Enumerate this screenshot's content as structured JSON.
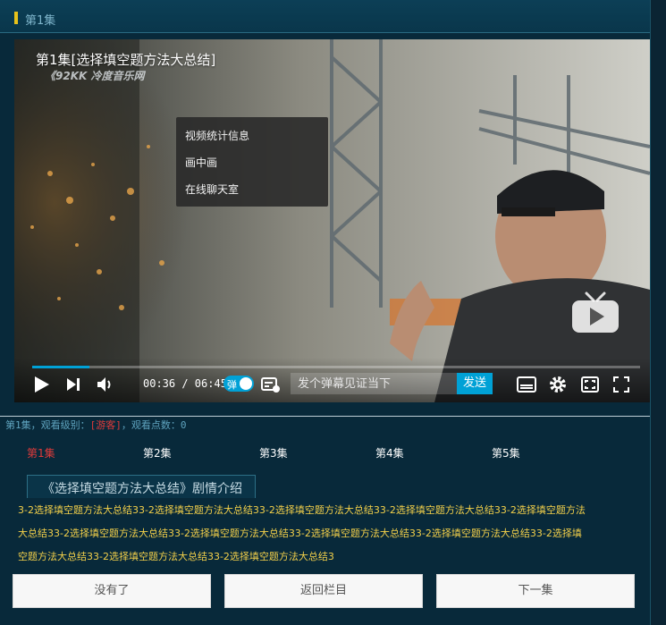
{
  "header": {
    "title": "第1集"
  },
  "player": {
    "video_title": "第1集[选择填空题方法大总结]",
    "watermark": "《92KK 冷度音乐网",
    "context_menu": [
      "视频统计信息",
      "画中画",
      "在线聊天室"
    ],
    "progress": 0.094,
    "time": "00:36 / 06:45",
    "danmaku_label": "弹",
    "danmaku_placeholder": "发个弹幕见证当下",
    "send_label": "发送"
  },
  "info": {
    "episode": "第1集，观看级别：",
    "guest": "[游客]",
    "points": "，观看点数：0"
  },
  "episodes": [
    {
      "label": "第1集",
      "active": true
    },
    {
      "label": "第2集",
      "active": false
    },
    {
      "label": "第3集",
      "active": false
    },
    {
      "label": "第4集",
      "active": false
    },
    {
      "label": "第5集",
      "active": false
    }
  ],
  "synopsis_tab": "《选择填空题方法大总结》剧情介绍",
  "synopsis_lines": [
    "3-2选择填空题方法大总结33-2选择填空题方法大总结33-2选择填空题方法大总结33-2选择填空题方法大总结33-2选择填空题方法",
    "大总结33-2选择填空题方法大总结33-2选择填空题方法大总结33-2选择填空题方法大总结33-2选择填空题方法大总结33-2选择填",
    "空题方法大总结33-2选择填空题方法大总结33-2选择填空题方法大总结3"
  ],
  "buttons": {
    "prev": "没有了",
    "back": "返回栏目",
    "next": "下一集"
  },
  "colors": {
    "accent": "#00a1d6",
    "active_episode": "#e03a3a",
    "synopsis_text": "#f3d04a",
    "header_bar": "#e8c21a"
  }
}
